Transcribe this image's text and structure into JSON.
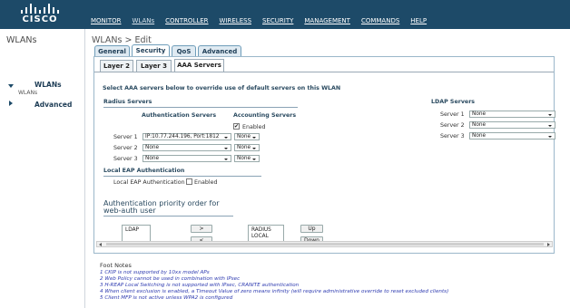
{
  "brand": {
    "logo_text": "CISCO"
  },
  "nav": [
    "MONITOR",
    "WLANs",
    "CONTROLLER",
    "WIRELESS",
    "SECURITY",
    "MANAGEMENT",
    "COMMANDS",
    "HELP"
  ],
  "sidebar": {
    "title": "WLANs",
    "wlans": "WLANs",
    "wlans_sub": "WLANs",
    "advanced": "Advanced"
  },
  "page_title": "WLANs > Edit",
  "tabs": [
    "General",
    "Security",
    "QoS",
    "Advanced"
  ],
  "subtabs": [
    "Layer 2",
    "Layer 3",
    "AAA Servers"
  ],
  "intro": "Select AAA servers below to override use of default servers on this WLAN",
  "radius": {
    "title": "Radius Servers",
    "auth_header": "Authentication Servers",
    "acct_header": "Accounting Servers",
    "enabled_label": "Enabled",
    "enabled_checked": "✔",
    "rows": [
      {
        "label": "Server 1",
        "auth": "IP:10.77.244.196, Port:1812",
        "acct": "None"
      },
      {
        "label": "Server 2",
        "auth": "None",
        "acct": "None"
      },
      {
        "label": "Server 3",
        "auth": "None",
        "acct": "None"
      }
    ]
  },
  "ldap": {
    "title": "LDAP Servers",
    "rows": [
      {
        "label": "Server 1",
        "value": "None"
      },
      {
        "label": "Server 2",
        "value": "None"
      },
      {
        "label": "Server 3",
        "value": "None"
      }
    ]
  },
  "local_eap": {
    "title": "Local EAP Authentication",
    "label": "Local EAP Authentication",
    "enabled_label": "Enabled"
  },
  "priority": {
    "title_line1": "Authentication priority order for",
    "title_line2": "web-auth user",
    "left_item": "LDAP",
    "right_items": [
      "RADIUS",
      "LOCAL"
    ],
    "move_right": ">",
    "move_left": "<",
    "up": "Up",
    "down": "Down"
  },
  "footnotes": {
    "title": "Foot Notes",
    "items": [
      "1 CKIP is not supported by 10xx model APs",
      "2 Web Policy cannot be used in combination with IPsec",
      "3 H-REAP Local Switching is not supported with IPsec, CRANITE authentication",
      "4 When client exclusion is enabled, a Timeout Value of zero means infinity (will require administrative override to reset excluded clients)",
      "5 Client MFP is not active unless WPA2 is configured"
    ]
  }
}
